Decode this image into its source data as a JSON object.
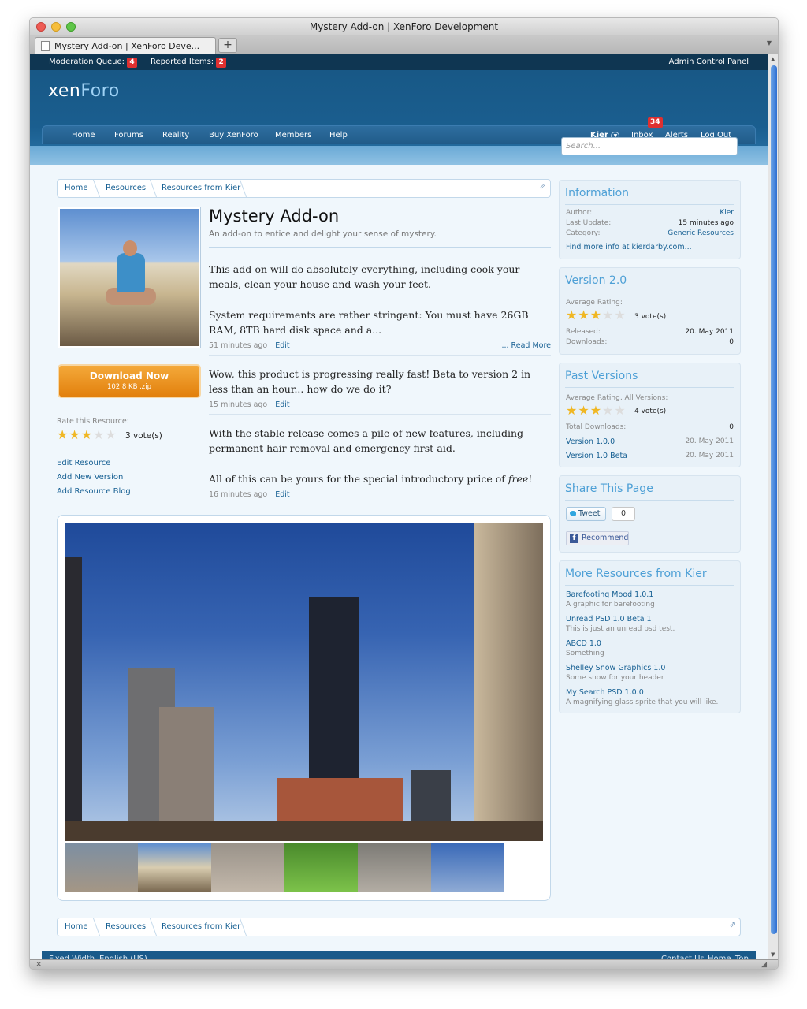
{
  "browser": {
    "window_title": "Mystery Add-on | XenForo Development",
    "tab_title": "Mystery Add-on | XenForo Deve...",
    "new_tab": "+"
  },
  "modbar": {
    "moderation_queue_label": "Moderation Queue:",
    "moderation_queue_count": "4",
    "reported_items_label": "Reported Items:",
    "reported_items_count": "2",
    "admin_cp": "Admin Control Panel"
  },
  "header": {
    "logo_a": "xen",
    "logo_b": "Foro",
    "nav": [
      "Home",
      "Forums",
      "Reality",
      "Buy XenForo",
      "Members",
      "Help"
    ],
    "user": "Kier",
    "inbox": "Inbox",
    "inbox_count": "34",
    "alerts": "Alerts",
    "logout": "Log Out",
    "search_placeholder": "Search..."
  },
  "breadcrumb": [
    "Home",
    "Resources",
    "Resources from Kier"
  ],
  "resource": {
    "title": "Mystery Add-on",
    "tagline": "An add-on to entice and delight your sense of mystery.",
    "download_label": "Download Now",
    "download_size": "102.8 KB .zip",
    "rate_label": "Rate this Resource:",
    "rating_stars": 3,
    "rating_votes": "3 vote(s)",
    "edit_resource": "Edit Resource",
    "add_new_version": "Add New Version",
    "add_resource_blog": "Add Resource Blog"
  },
  "updates": [
    {
      "p1": "This add-on will do absolutely everything, including cook your meals, clean your house and wash your feet.",
      "p2": "System requirements are rather stringent: You must have 26GB RAM, 8TB hard disk space and a...",
      "time": "51 minutes ago",
      "edit": "Edit",
      "read_more": "... Read More"
    },
    {
      "p1": "Wow, this product is progressing really fast! Beta to version 2 in less than an hour... how do we do it?",
      "time": "15 minutes ago",
      "edit": "Edit"
    },
    {
      "p1": "With the stable release comes a pile of new features, including permanent hair removal and emergency first-aid.",
      "p2_before": "All of this can be yours for the special introductory price of ",
      "p2_em": "free",
      "p2_after": "!",
      "time": "16 minutes ago",
      "edit": "Edit"
    }
  ],
  "sidebar": {
    "information": {
      "title": "Information",
      "author_label": "Author:",
      "author": "Kier",
      "last_update_label": "Last Update:",
      "last_update": "15 minutes ago",
      "category_label": "Category:",
      "category": "Generic Resources",
      "more_info": "Find more info at kierdarby.com..."
    },
    "version": {
      "title": "Version 2.0",
      "avg_rating_label": "Average Rating:",
      "stars": 3,
      "votes": "3 vote(s)",
      "released_label": "Released:",
      "released": "20. May 2011",
      "downloads_label": "Downloads:",
      "downloads": "0"
    },
    "past_versions": {
      "title": "Past Versions",
      "avg_rating_label": "Average Rating, All Versions:",
      "stars": 3,
      "votes": "4 vote(s)",
      "total_downloads_label": "Total Downloads:",
      "total_downloads": "0",
      "versions": [
        {
          "name": "Version 1.0.0",
          "date": "20. May 2011"
        },
        {
          "name": "Version 1.0 Beta",
          "date": "20. May 2011"
        }
      ]
    },
    "share": {
      "title": "Share This Page",
      "tweet": "Tweet",
      "tweet_count": "0",
      "recommend": "Recommend"
    },
    "more_resources": {
      "title": "More Resources from Kier",
      "items": [
        {
          "name": "Barefooting Mood 1.0.1",
          "desc": "A graphic for barefooting"
        },
        {
          "name": "Unread PSD 1.0 Beta 1",
          "desc": "This is just an unread psd test."
        },
        {
          "name": "ABCD 1.0",
          "desc": "Something"
        },
        {
          "name": "Shelley Snow Graphics 1.0",
          "desc": "Some snow for your header"
        },
        {
          "name": "My Search PSD 1.0.0",
          "desc": "A magnifying glass sprite that you will like."
        }
      ]
    }
  },
  "footer": {
    "fixed_width": "Fixed Width",
    "language": "English (US)",
    "contact": "Contact Us",
    "home": "Home",
    "top": "Top"
  },
  "colors": {
    "header_blue": "#185886",
    "link_blue": "#176093",
    "sidebar_heading": "#4ea0d6",
    "download_orange": "#e2800d",
    "badge_red": "#e03030",
    "star_gold": "#f0b723"
  }
}
